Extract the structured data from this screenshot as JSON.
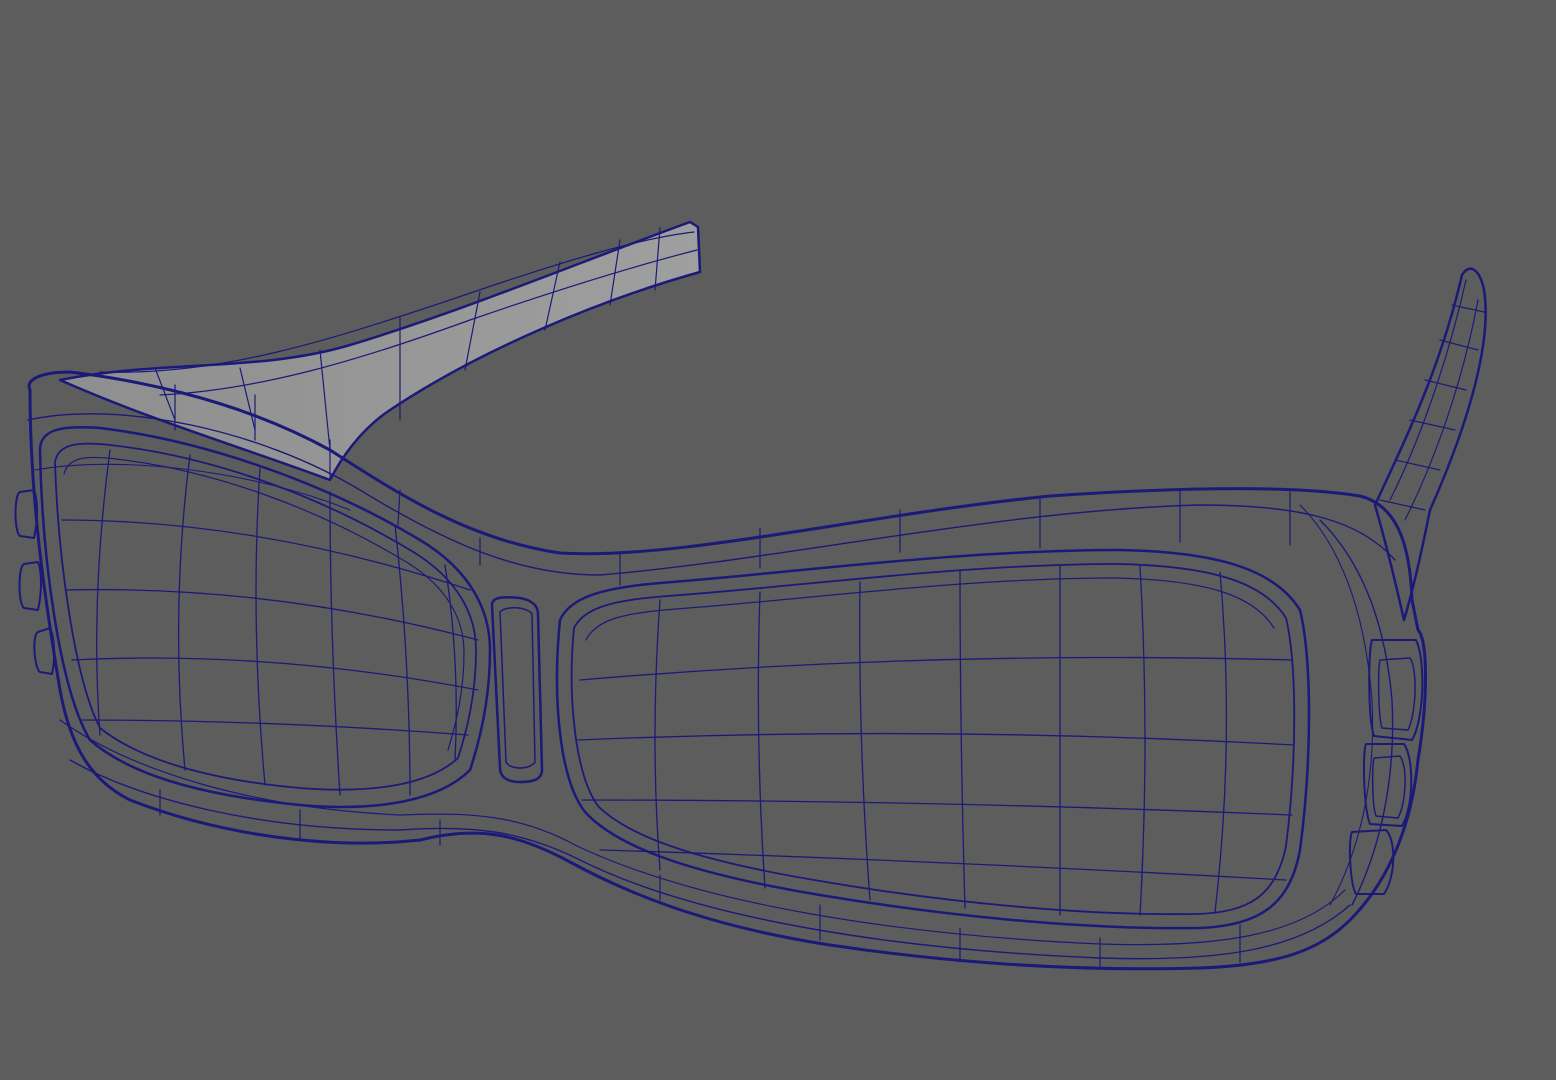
{
  "viewport": {
    "background_color": "#5d5d5d",
    "shading": "smooth-shaded-with-wireframe",
    "surface_color": "#9d9d9d",
    "surface_shadow_color": "#8a8a8a",
    "wireframe_color": "#1c1a78",
    "model": "goggles-mesh"
  }
}
